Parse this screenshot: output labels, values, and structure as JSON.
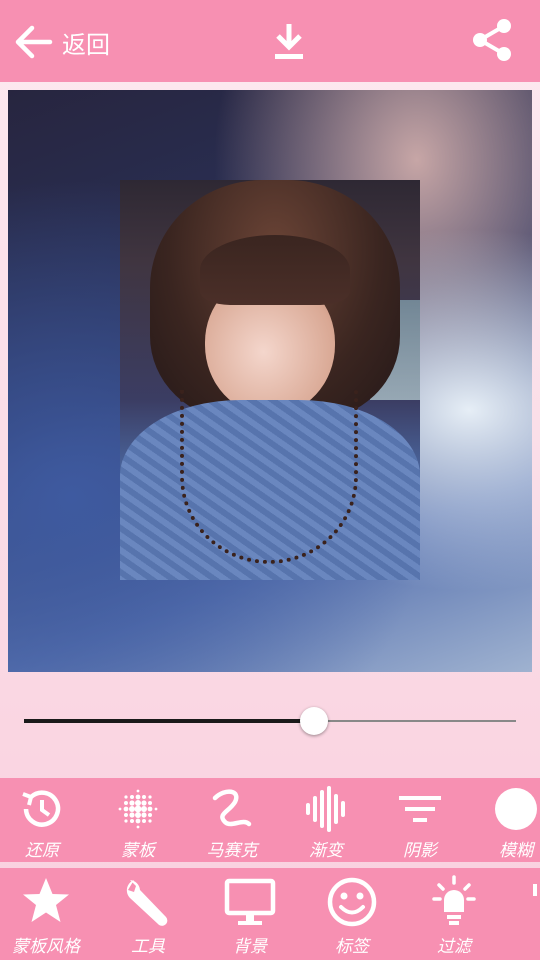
{
  "header": {
    "back_label": "返回",
    "back_icon": "arrow-left-icon",
    "download_icon": "download-icon",
    "share_icon": "share-icon"
  },
  "slider": {
    "value": 0.59
  },
  "effects_toolbar": {
    "items": [
      {
        "label": "还原",
        "icon": "history-icon"
      },
      {
        "label": "蒙板",
        "icon": "dot-grid-icon"
      },
      {
        "label": "马赛克",
        "icon": "squiggle-icon"
      },
      {
        "label": "渐变",
        "icon": "sound-wave-icon"
      },
      {
        "label": "阴影",
        "icon": "filter-lines-icon"
      },
      {
        "label": "模糊",
        "icon": "circle-icon"
      }
    ]
  },
  "main_toolbar": {
    "items": [
      {
        "label": "蒙板风格",
        "icon": "star-icon"
      },
      {
        "label": "工具",
        "icon": "wrench-icon"
      },
      {
        "label": "背景",
        "icon": "monitor-icon"
      },
      {
        "label": "标签",
        "icon": "smiley-icon"
      },
      {
        "label": "过滤",
        "icon": "lightbulb-icon"
      }
    ]
  },
  "colors": {
    "accent": "#f790b2",
    "background": "#fde9f0"
  }
}
